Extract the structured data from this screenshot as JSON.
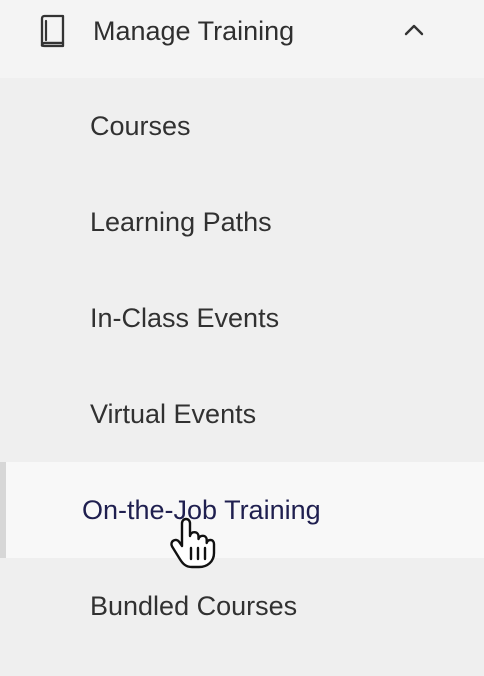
{
  "sidebar": {
    "section": {
      "title": "Manage Training",
      "icon": "book-icon",
      "toggle_icon": "chevron-up-icon"
    },
    "items": [
      {
        "label": "Courses",
        "active": false
      },
      {
        "label": "Learning Paths",
        "active": false
      },
      {
        "label": "In-Class Events",
        "active": false
      },
      {
        "label": "Virtual Events",
        "active": false
      },
      {
        "label": "On-the-Job Training",
        "active": true
      },
      {
        "label": "Bundled Courses",
        "active": false
      }
    ],
    "colors": {
      "background": "#efefef",
      "header": "#f4f4f4",
      "active_background": "#f8f8f8",
      "active_text": "#1f1f4f",
      "text": "#313131",
      "active_bar": "#d7d7d7"
    }
  },
  "pointer": {
    "icon": "hand-pointer-icon"
  }
}
